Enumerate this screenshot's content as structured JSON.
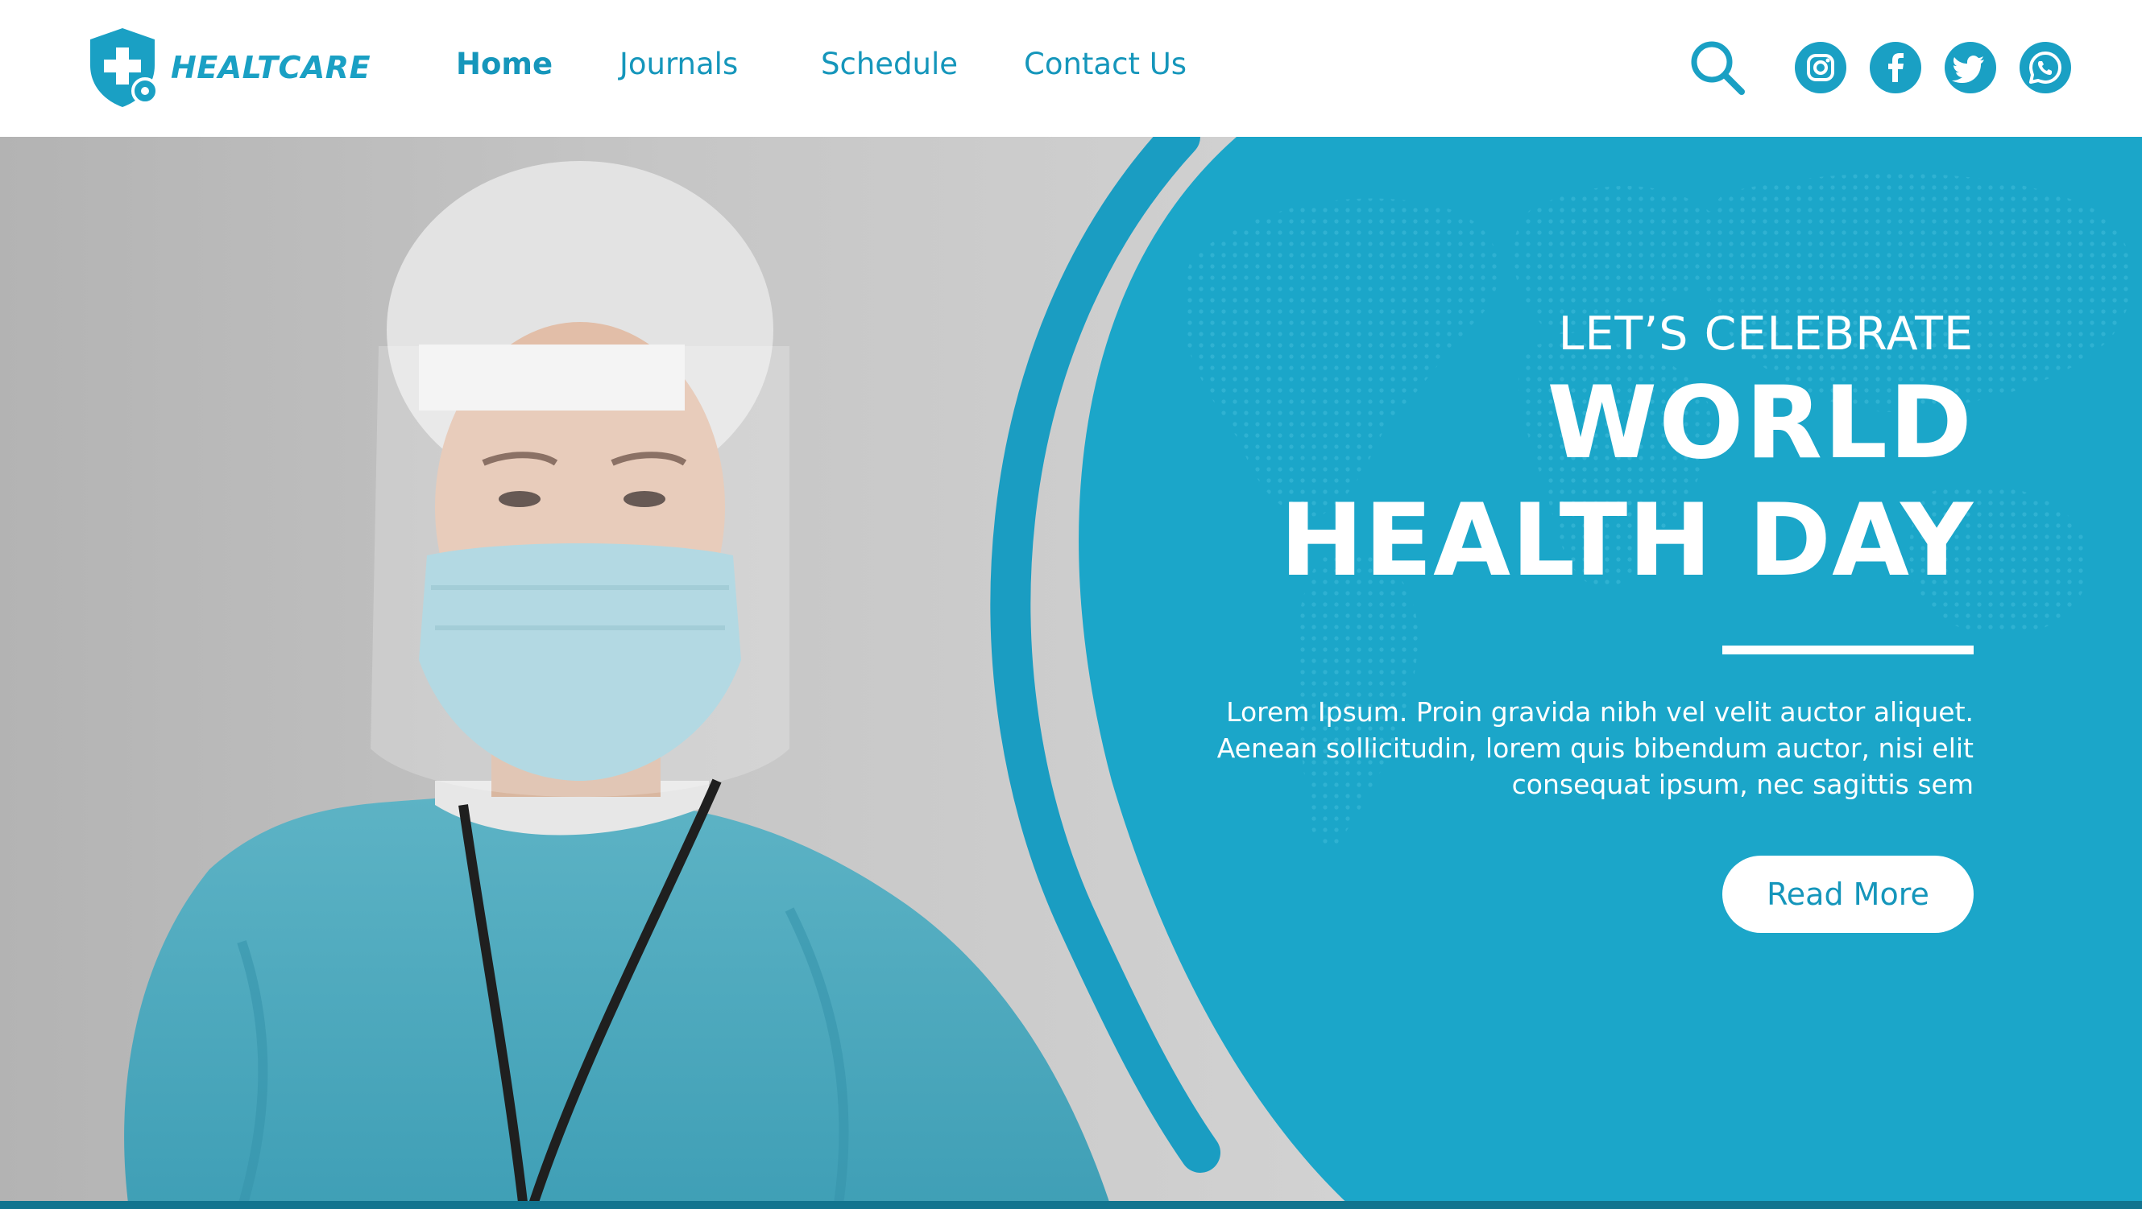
{
  "brand": {
    "name": "HEALTCARE"
  },
  "nav": {
    "items": [
      {
        "label": "Home",
        "active": true
      },
      {
        "label": "Journals",
        "active": false
      },
      {
        "label": "Schedule",
        "active": false
      },
      {
        "label": "Contact Us",
        "active": false
      }
    ]
  },
  "header_icons": {
    "search": "search-icon",
    "social": [
      "instagram-icon",
      "facebook-icon",
      "twitter-icon",
      "whatsapp-icon"
    ]
  },
  "hero": {
    "eyebrow": "LET’S CELEBRATE",
    "title_line1": "WORLD",
    "title_line2": "HEALTH DAY",
    "body": "Lorem Ipsum. Proin gravida nibh vel velit auctor aliquet. Aenean sollicitudin, lorem quis bibendum auctor, nisi elit consequat ipsum, nec sagittis sem",
    "cta_label": "Read More"
  },
  "colors": {
    "accent": "#1aa0c4",
    "nav_text": "#1596bb",
    "hero_panel": "#1ba6c9",
    "photo_gray": "#b8b8b8",
    "bottom_bar": "#11748f"
  }
}
